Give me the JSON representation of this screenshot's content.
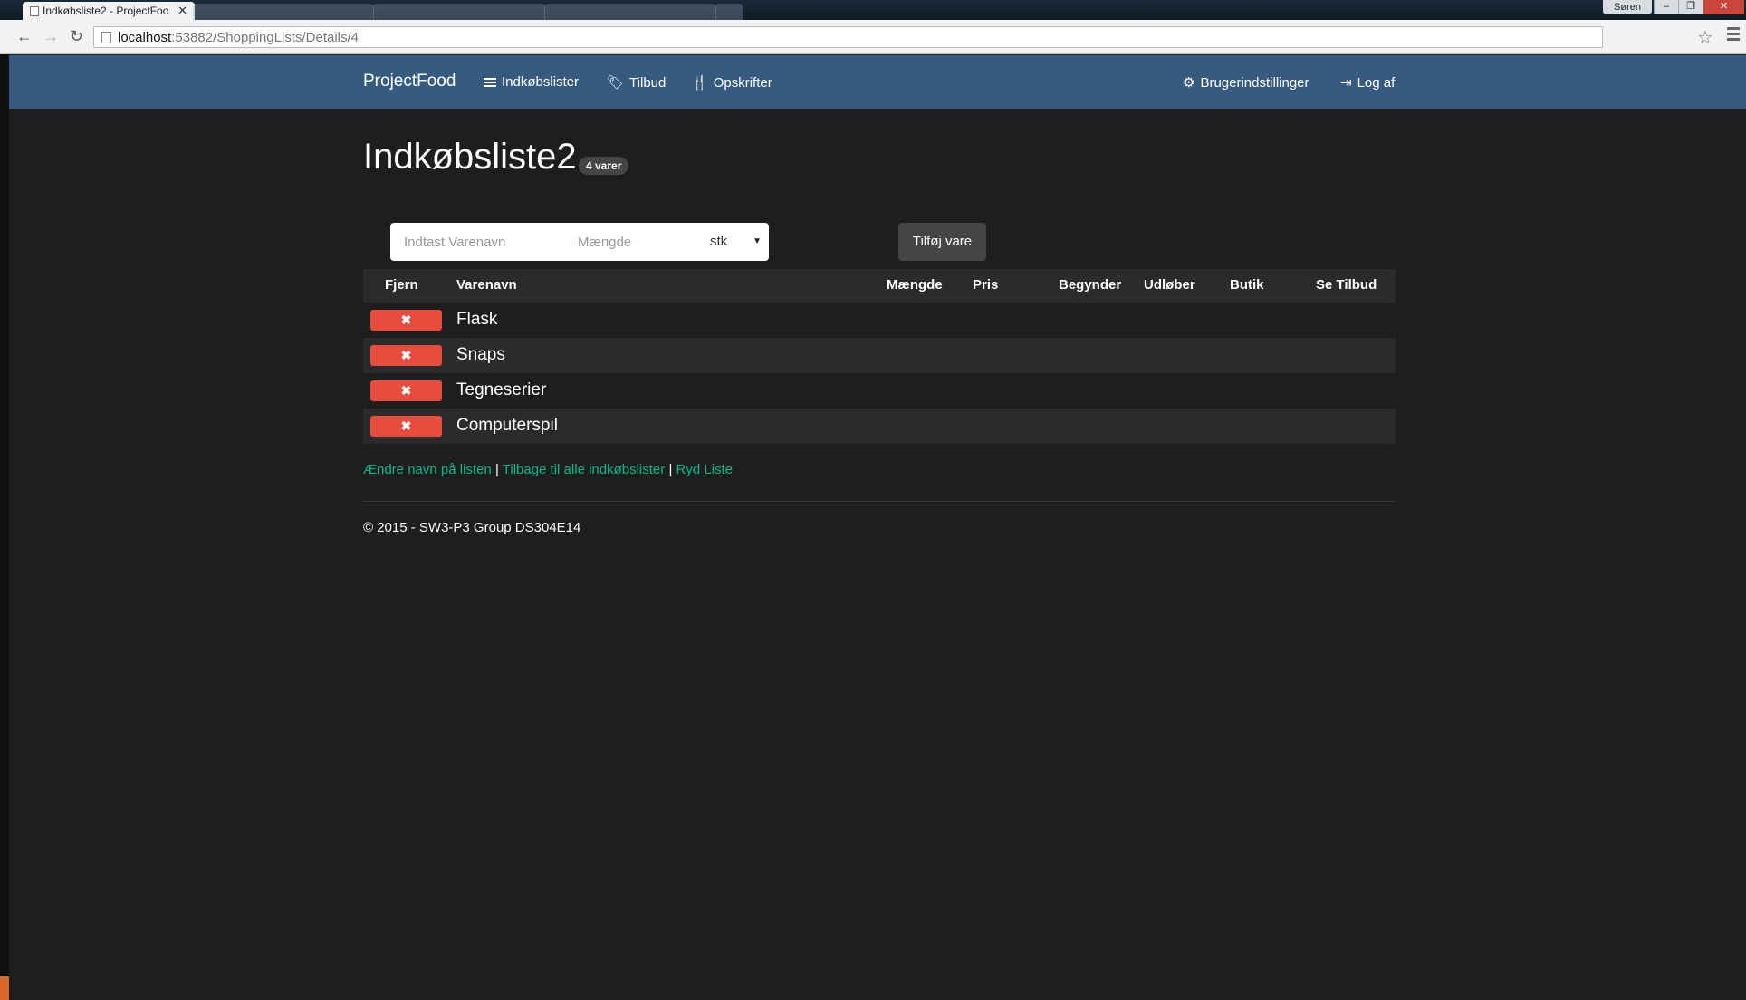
{
  "browser": {
    "active_tab_title": "Indkøbsliste2 - ProjectFoo",
    "url_host": "localhost",
    "url_path": ":53882/ShoppingLists/Details/4",
    "window_user": "Søren"
  },
  "navbar": {
    "brand": "ProjectFood",
    "items": [
      {
        "label": "Indkøbslister",
        "icon": "list-icon"
      },
      {
        "label": "Tilbud",
        "icon": "tags-icon"
      },
      {
        "label": "Opskrifter",
        "icon": "cutlery-icon"
      }
    ],
    "right_items": [
      {
        "label": "Brugerindstillinger",
        "icon": "gear-icon"
      },
      {
        "label": "Log af",
        "icon": "logout-icon"
      }
    ]
  },
  "page": {
    "title": "Indkøbsliste2",
    "badge": "4 varer"
  },
  "form": {
    "name_placeholder": "Indtast Varenavn",
    "qty_placeholder": "Mængde",
    "unit": "stk",
    "add_label": "Tilføj vare"
  },
  "table": {
    "headers": [
      "Fjern",
      "Varenavn",
      "Mængde",
      "Pris",
      "Begynder",
      "Udløber",
      "Butik",
      "Se Tilbud"
    ],
    "remove_glyph": "✖",
    "rows": [
      {
        "name": "Flask"
      },
      {
        "name": "Snaps"
      },
      {
        "name": "Tegneserier"
      },
      {
        "name": "Computerspil"
      }
    ]
  },
  "links": {
    "rename": "Ændre navn på listen",
    "back": "Tilbage til alle indkøbslister",
    "clear": "Ryd Liste",
    "separator": "|"
  },
  "footer": {
    "text": "© 2015 - SW3-P3 Group DS304E14"
  }
}
